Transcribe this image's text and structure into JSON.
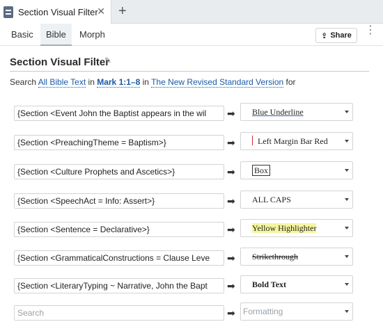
{
  "tabstrip": {
    "tab_title": "Section Visual Filter",
    "close": "✕",
    "add": "+"
  },
  "subtabs": [
    {
      "label": "Basic"
    },
    {
      "label": "Bible"
    },
    {
      "label": "Morph"
    }
  ],
  "toolbar": {
    "share_label": "Share",
    "share_icon": "⇪",
    "more_icon": "⋮"
  },
  "header": {
    "title": "Section Visual Filter",
    "edit_icon": "✎"
  },
  "search_line": {
    "prefix": "Search",
    "scope": "All Bible Text",
    "in1": "in",
    "reference": "Mark 1:1–8",
    "in2": "in",
    "version": "The New Revised Standard Version",
    "suffix": "for"
  },
  "rows": [
    {
      "condition": "{Section <Event John the Baptist appears in the wil",
      "format": "Blue Underline"
    },
    {
      "condition": "{Section <PreachingTheme = Baptism>}",
      "format": "Left Margin Bar Red"
    },
    {
      "condition": "{Section <Culture Prophets and Ascetics>}",
      "format": "Box"
    },
    {
      "condition": "{Section <SpeechAct = Info: Assert>}",
      "format": "ALL CAPS"
    },
    {
      "condition": "{Section <Sentence = Declarative>}",
      "format": "Yellow Highlighter"
    },
    {
      "condition": "{Section <GrammaticalConstructions = Clause Leve",
      "format": "Strikethrough"
    },
    {
      "condition": "{Section <LiteraryTyping ~ Narrative, John the Bapt",
      "format": "Bold Text"
    }
  ],
  "new_row": {
    "search_placeholder": "Search",
    "format_placeholder": "Formatting"
  },
  "arrow_icon": "➡",
  "colors": {
    "link": "#1a5aa6",
    "highlight": "#f4f6a0",
    "margin_bar": "#d02c2c"
  }
}
